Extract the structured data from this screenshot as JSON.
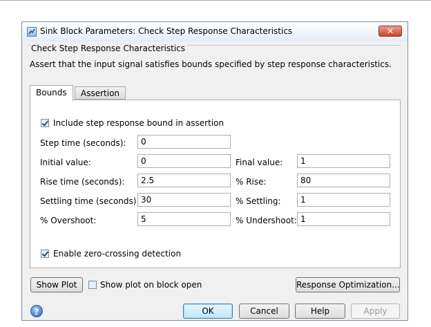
{
  "window": {
    "title": "Sink Block Parameters: Check Step Response Characteristics",
    "close_glyph": "✕"
  },
  "block": {
    "name": "Check Step Response Characteristics",
    "description": "Assert that the input signal satisfies bounds specified by step response characteristics."
  },
  "tabs": [
    {
      "label": "Bounds",
      "active": true
    },
    {
      "label": "Assertion",
      "active": false
    }
  ],
  "bounds": {
    "include_bound": {
      "label": "Include step response bound in assertion",
      "checked": true
    },
    "step_time": {
      "label": "Step time (seconds):",
      "value": "0"
    },
    "initial_value": {
      "label": "Initial value:",
      "value": "0"
    },
    "final_value": {
      "label": "Final value:",
      "value": "1"
    },
    "rise_time": {
      "label": "Rise time (seconds):",
      "value": "2.5"
    },
    "percent_rise": {
      "label": "% Rise:",
      "value": "80"
    },
    "settling_time": {
      "label": "Settling time (seconds):",
      "value": "30"
    },
    "percent_settling": {
      "label": "% Settling:",
      "value": "1"
    },
    "overshoot": {
      "label": "% Overshoot:",
      "value": "5"
    },
    "undershoot": {
      "label": "% Undershoot:",
      "value": "1"
    },
    "zero_crossing": {
      "label": "Enable zero-crossing detection",
      "checked": true
    }
  },
  "plot": {
    "show_plot_label": "Show Plot",
    "show_on_open": {
      "label": "Show plot on block open",
      "checked": false
    },
    "response_optimization_label": "Response Optimization..."
  },
  "footer": {
    "help_glyph": "?",
    "ok_label": "OK",
    "cancel_label": "Cancel",
    "help_label": "Help",
    "apply_label": "Apply"
  }
}
